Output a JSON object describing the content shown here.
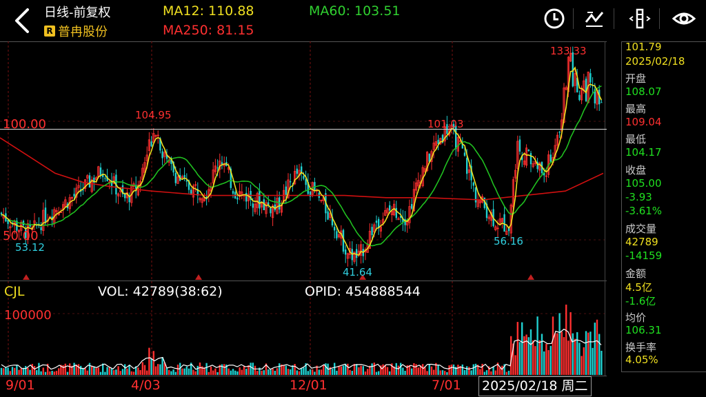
{
  "header": {
    "title": "日线-前复权",
    "stock_badge": "R",
    "stock_name": "普冉股份",
    "ma12": "MA12: 110.88",
    "ma60": "MA60: 103.51",
    "ma250": "MA250: 81.15",
    "icons": [
      "back-chevron-icon",
      "clock-icon",
      "draw-line-icon",
      "expand-bars-icon",
      "eye-icon"
    ]
  },
  "price_panel": {
    "price_level_high": "100.00",
    "price_level_low": "50.00",
    "points": {
      "p_104_95": "104.95",
      "p_101_03": "101.03",
      "p_133_33": "133.33",
      "p_53_12": "53.12",
      "p_41_64": "41.64",
      "p_56_16": "56.16"
    }
  },
  "volume_panel": {
    "label": "CJL",
    "vol": "VOL: 42789(38:62)",
    "opid": "OPID: 454888544",
    "level": "100000"
  },
  "x_axis": {
    "labels": [
      "9/01",
      "4/03",
      "12/01",
      "7/01"
    ],
    "cursor_date": "2025/02/18 周二"
  },
  "sidebar": {
    "price": "101.79",
    "date": "2025/02/18",
    "open_label": "开盘",
    "open": "108.07",
    "high_label": "最高",
    "high": "109.04",
    "low_label": "最低",
    "low": "104.17",
    "close_label": "收盘",
    "close": "105.00",
    "change": "-3.93",
    "change_pct": "-3.61%",
    "volume_label": "成交量",
    "volume": "42789",
    "volume_change": "-14159",
    "amount_label": "金额",
    "amount": "4.5亿",
    "amount_change": "-1.6亿",
    "avg_label": "均价",
    "avg": "106.31",
    "turnover_label": "换手率",
    "turnover": "4.05%"
  },
  "colors": {
    "up": "#ff3030",
    "down": "#20d0d0",
    "ma12": "#f0e020",
    "ma60": "#20c020",
    "ma250": "#e01010"
  }
}
